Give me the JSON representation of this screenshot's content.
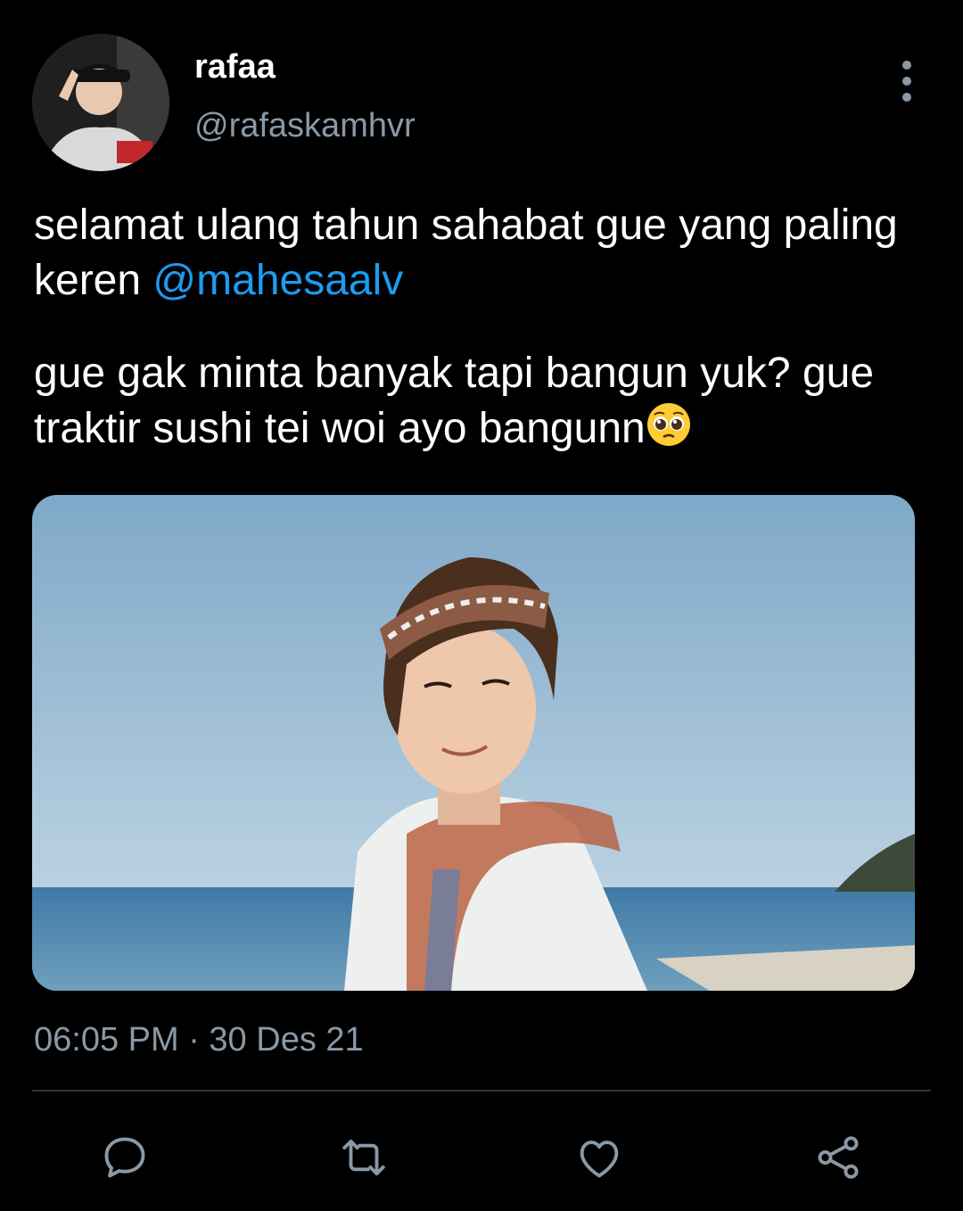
{
  "author": {
    "display_name": "rafaa",
    "handle": "@rafaskamhvr",
    "avatar_icon": "avatar-photo"
  },
  "tweet": {
    "line1": "selamat ulang tahun sahabat gue yang paling keren ",
    "mention": "@mahesaalv",
    "line2": "gue gak minta banyak tapi bangun yuk? gue traktir sushi tei woi ayo bangunn",
    "emoji": "pleading-face-emoji"
  },
  "meta": {
    "timestamp": "06:05 PM · 30 Des 21"
  },
  "actions": {
    "reply_icon": "reply-icon",
    "retweet_icon": "retweet-icon",
    "like_icon": "heart-icon",
    "share_icon": "share-icon"
  },
  "colors": {
    "background": "#000000",
    "text": "#ffffff",
    "secondary_text": "#8b98a5",
    "link": "#1d9bf0",
    "divider": "#2f3336"
  }
}
